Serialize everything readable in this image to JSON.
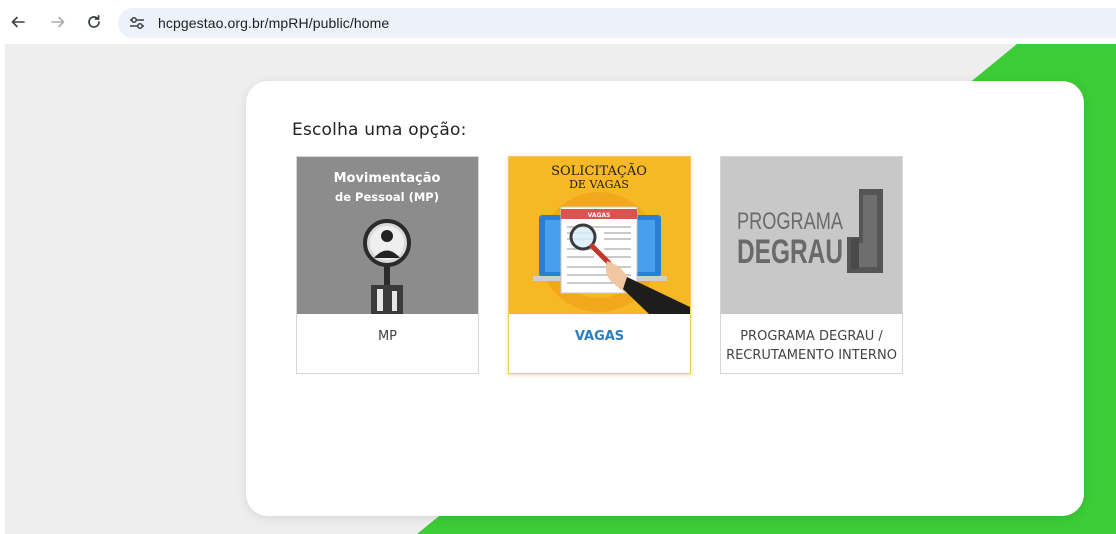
{
  "browser": {
    "url": "hcpgestao.org.br/mpRH/public/home",
    "back_icon": "arrow-left-icon",
    "forward_icon": "arrow-right-icon",
    "reload_icon": "reload-icon",
    "site_info_icon": "tune-icon"
  },
  "page": {
    "heading": "Escolha uma opção:",
    "accent_color": "#3ccc35",
    "options": [
      {
        "label": "MP",
        "image_text_1": "Movimentação",
        "image_text_2": "de Pessoal (MP)",
        "image_bg": "#8c8c8c",
        "selected": false
      },
      {
        "label": "VAGAS",
        "image_text_1": "SOLICITAÇÃO",
        "image_text_2": "DE VAGAS",
        "image_badge": "VAGAS",
        "image_bg": "#f6b824",
        "selected": true
      },
      {
        "label_line_1": "PROGRAMA DEGRAU /",
        "label_line_2": "RECRUTAMENTO INTERNO",
        "image_text_1": "PROGRAMA",
        "image_text_2": "DEGRAU",
        "image_bg": "#c8c8c8",
        "selected": false
      }
    ]
  }
}
